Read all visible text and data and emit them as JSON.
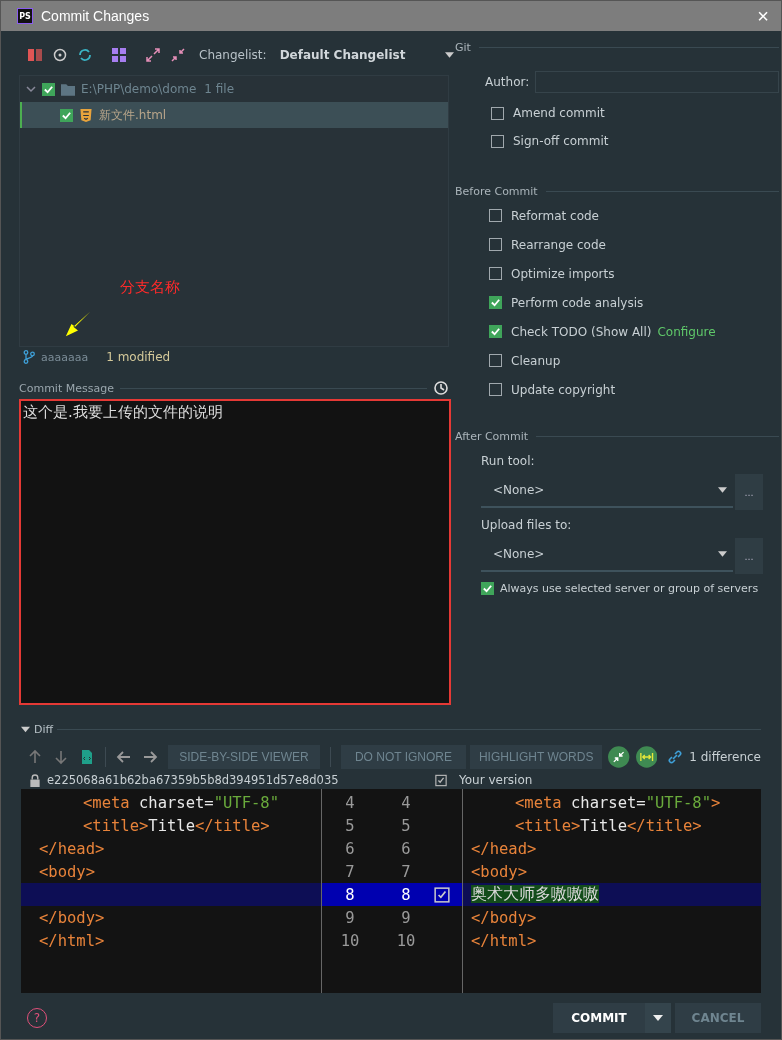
{
  "window": {
    "app_icon": "PS",
    "title": "Commit Changes",
    "close": "×"
  },
  "toolbar": {
    "changelist_label": "Changelist:",
    "changelist": "Default Changelist"
  },
  "tree": [
    {
      "label": "E:\\PHP\\demo\\dome",
      "count": "1 file",
      "checked": true,
      "expanded": true,
      "selected": false,
      "children": [
        {
          "label": "新文件.html",
          "checked": true,
          "selected": true
        }
      ]
    }
  ],
  "annotation": {
    "text": "分支名称"
  },
  "branch": {
    "name": "aaaaaaa",
    "status": "1 modified"
  },
  "commit_message": {
    "label": "Commit Message",
    "value": "这个是.我要上传的文件的说明"
  },
  "git": {
    "title": "Git",
    "author_label": "Author:",
    "options": [
      {
        "label": "Amend commit",
        "checked": false
      },
      {
        "label": "Sign-off commit",
        "checked": false
      }
    ]
  },
  "before_commit": {
    "title": "Before Commit",
    "options": [
      {
        "label": "Reformat code",
        "checked": false
      },
      {
        "label": "Rearrange code",
        "checked": false
      },
      {
        "label": "Optimize imports",
        "checked": false
      },
      {
        "label": "Perform code analysis",
        "checked": true
      },
      {
        "label": "Check TODO (Show All)",
        "checked": true,
        "link": "Configure"
      },
      {
        "label": "Cleanup",
        "checked": false
      },
      {
        "label": "Update copyright",
        "checked": false
      }
    ]
  },
  "after_commit": {
    "title": "After Commit",
    "dropdowns": [
      {
        "label": "Run tool:",
        "value": "<None>",
        "more": "..."
      },
      {
        "label": "Upload files to:",
        "value": "<None>",
        "more": "..."
      }
    ],
    "options": [
      {
        "label": "Always use selected server or group of servers",
        "checked": true
      }
    ]
  },
  "diff": {
    "title": "Diff",
    "expanded": true,
    "viewer": "SIDE-BY-SIDE VIEWER",
    "ignore": "DO NOT IGNORE",
    "highlight": "HIGHLIGHT WORDS",
    "count": "1 difference",
    "left_title": "e225068a61b62ba67359b5b8d394951d57e8d035",
    "right_title": "Your version",
    "right_title_checked": true,
    "lines": [
      {
        "left_no": "4",
        "right_no": "4",
        "changed": false,
        "left": [
          {
            "kind": "tag",
            "text": "<meta"
          },
          {
            "kind": "text",
            "text": " charset="
          },
          {
            "kind": "string",
            "text": "\"UTF-8\""
          }
        ],
        "right": [
          {
            "kind": "tag",
            "text": "<meta"
          },
          {
            "kind": "text",
            "text": " charset="
          },
          {
            "kind": "string",
            "text": "\"UTF-8\""
          },
          {
            "kind": "tag",
            "text": ">"
          }
        ]
      },
      {
        "left_no": "5",
        "right_no": "5",
        "changed": false,
        "left": [
          {
            "kind": "tag",
            "text": "<title>"
          },
          {
            "kind": "text",
            "text": "Title"
          },
          {
            "kind": "tag",
            "text": "</title>"
          }
        ],
        "right": [
          {
            "kind": "tag",
            "text": "<title>"
          },
          {
            "kind": "text",
            "text": "Title"
          },
          {
            "kind": "tag",
            "text": "</title>"
          }
        ]
      },
      {
        "left_no": "6",
        "right_no": "6",
        "changed": false,
        "left": [
          {
            "kind": "tag",
            "text": "</head>"
          }
        ],
        "right": [
          {
            "kind": "tag",
            "text": "</head>"
          }
        ]
      },
      {
        "left_no": "7",
        "right_no": "7",
        "changed": false,
        "left": [
          {
            "kind": "tag",
            "text": "<body>"
          }
        ],
        "right": [
          {
            "kind": "tag",
            "text": "<body>"
          }
        ]
      },
      {
        "left_no": "8",
        "right_no": "8",
        "changed": true,
        "right": [
          {
            "kind": "inserted",
            "text": "奥术大师多嗷嗷嗷"
          }
        ]
      },
      {
        "left_no": "9",
        "right_no": "9",
        "changed": false,
        "left": [
          {
            "kind": "tag",
            "text": "</body>"
          }
        ],
        "right": [
          {
            "kind": "tag",
            "text": "</body>"
          }
        ]
      },
      {
        "left_no": "10",
        "right_no": "10",
        "changed": false,
        "left": [
          {
            "kind": "tag",
            "text": "</html>"
          }
        ],
        "right": [
          {
            "kind": "tag",
            "text": "</html>"
          }
        ]
      }
    ]
  },
  "buttons": {
    "help": "?",
    "commit": "COMMIT",
    "cancel": "CANCEL"
  }
}
